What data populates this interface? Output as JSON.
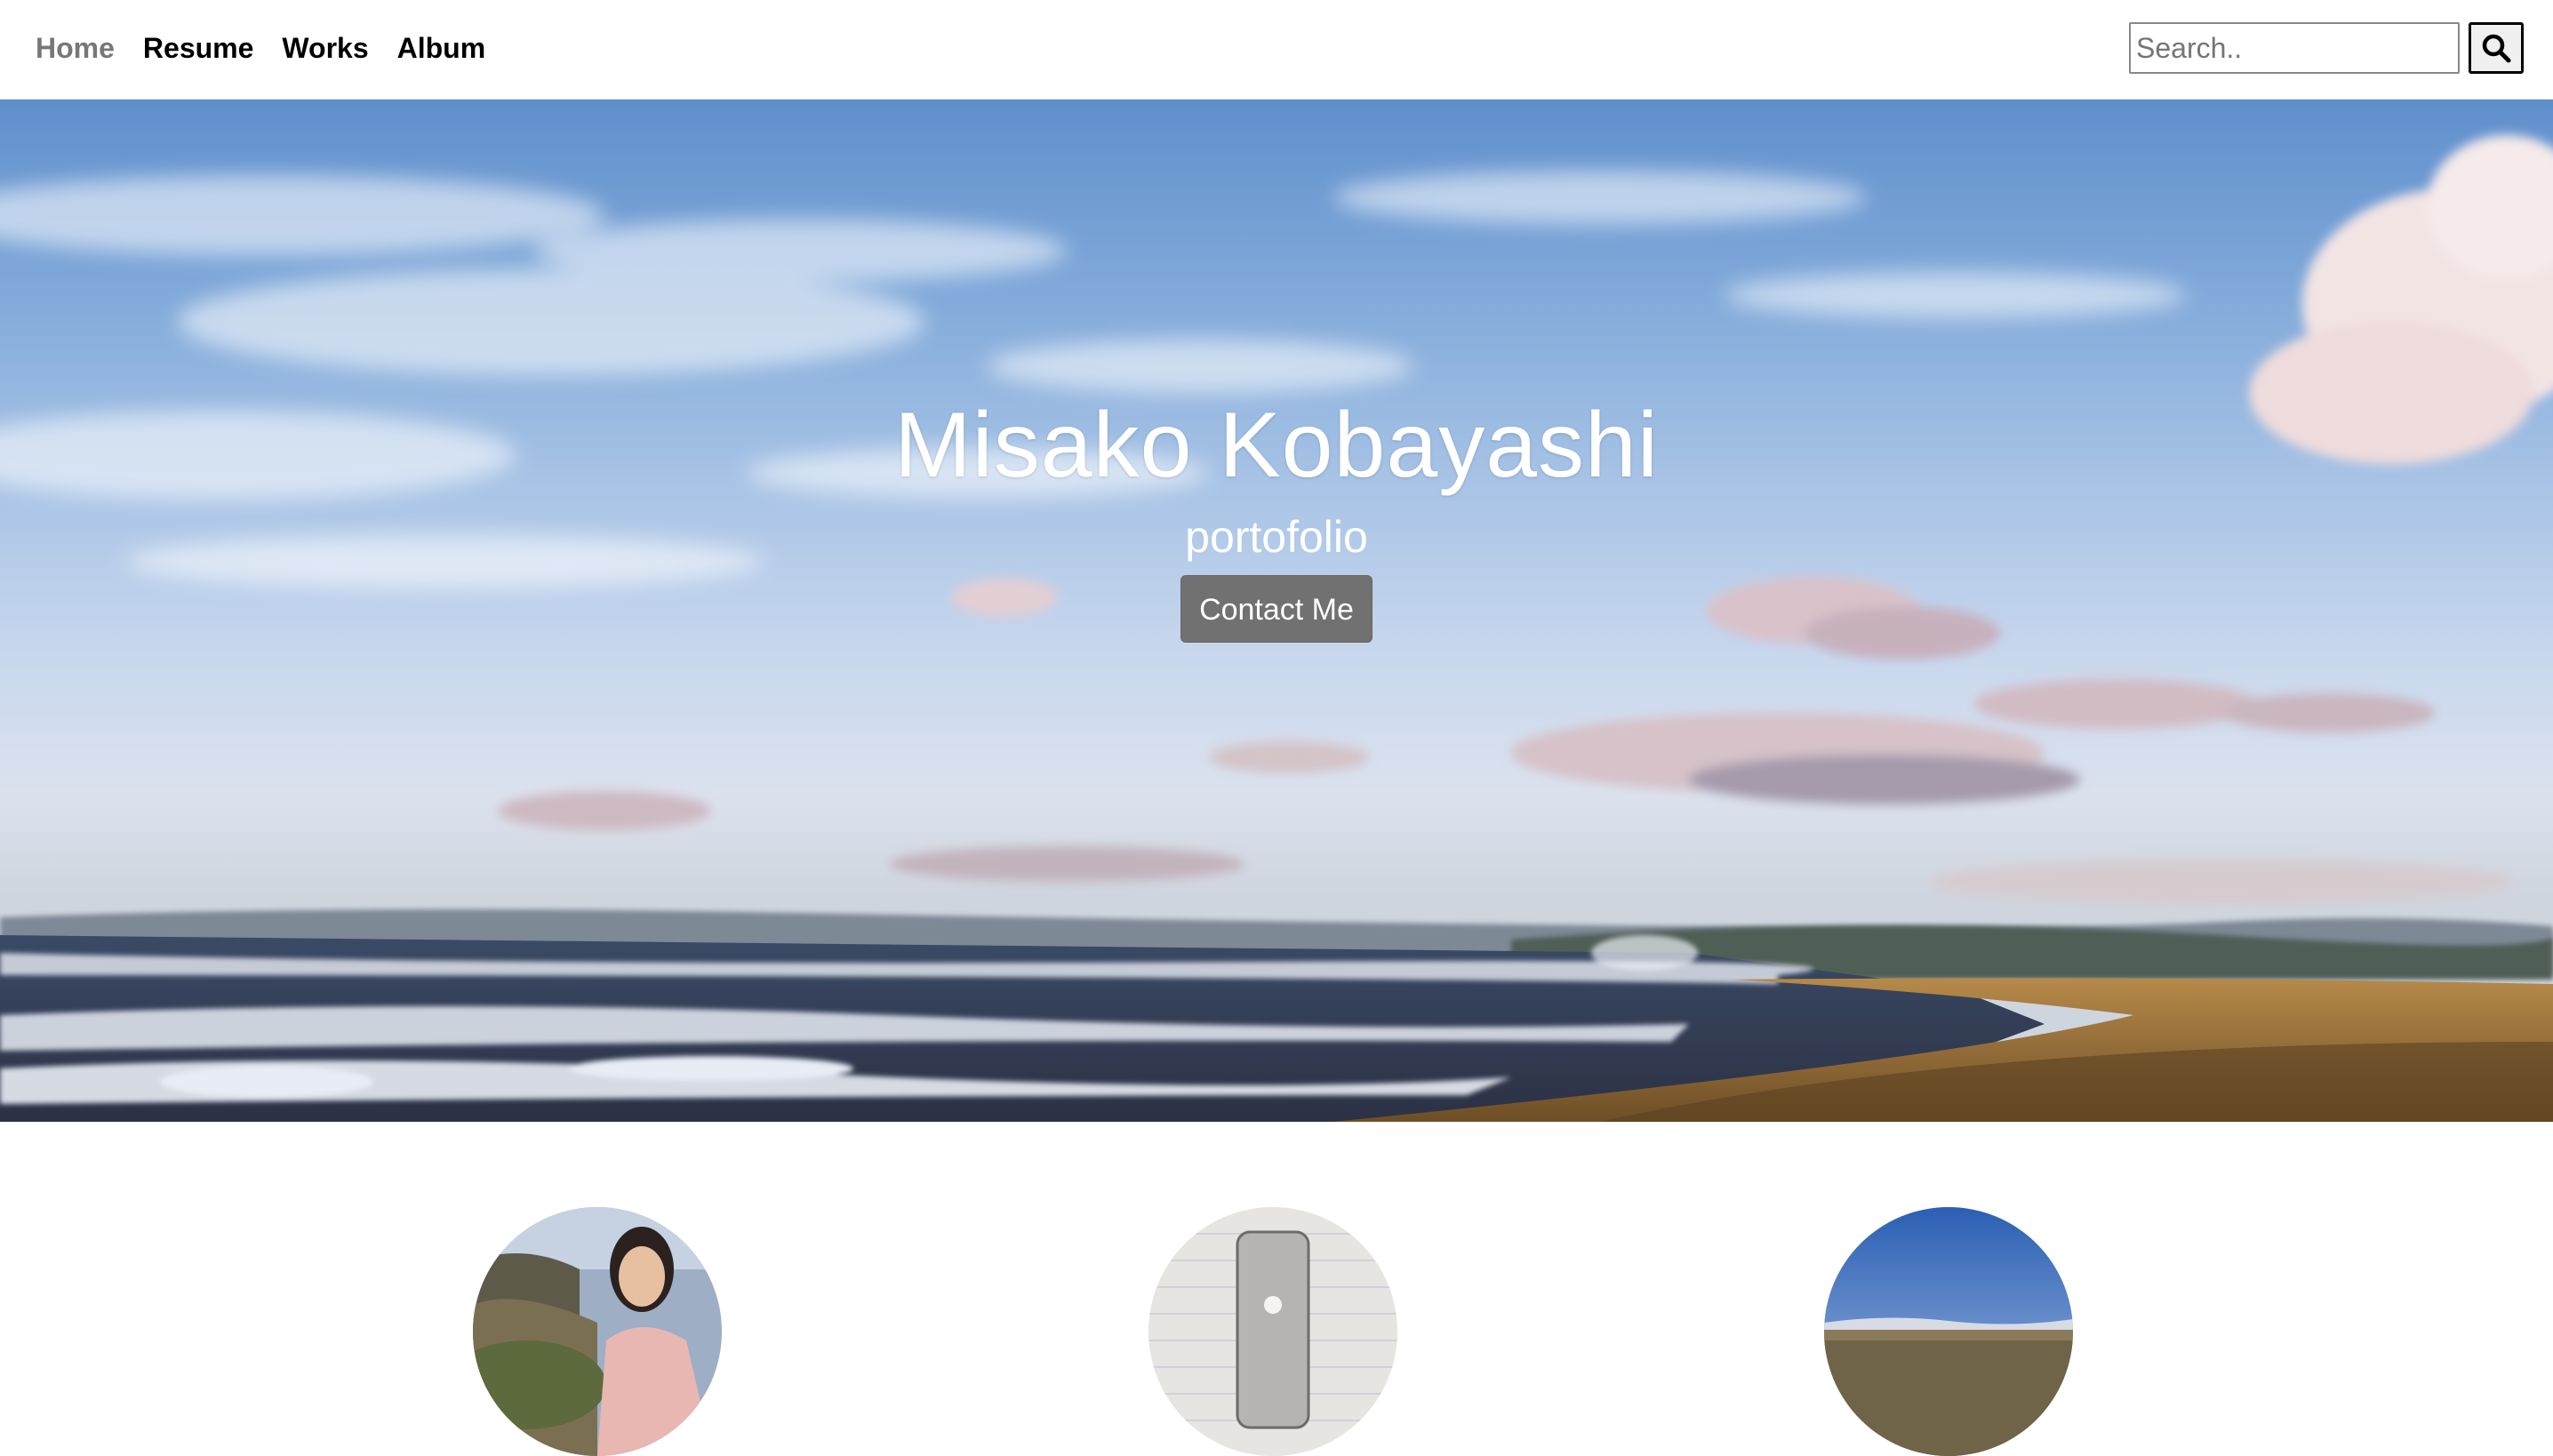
{
  "nav": {
    "links": [
      {
        "label": "Home",
        "active": true
      },
      {
        "label": "Resume",
        "active": false
      },
      {
        "label": "Works",
        "active": false
      },
      {
        "label": "Album",
        "active": false
      }
    ],
    "search": {
      "placeholder": "Search..",
      "button_icon": "search-icon"
    }
  },
  "hero": {
    "title": "Misako Kobayashi",
    "subtitle": "portofolio",
    "contact_label": "Contact Me",
    "background": "beach-sky-photo"
  },
  "cards": [
    {
      "image": "person-at-rocky-shore-photo"
    },
    {
      "image": "phone-sketch-photo"
    },
    {
      "image": "desert-sky-photo"
    }
  ],
  "colors": {
    "nav_active": "#777777",
    "nav_text": "#000000",
    "button_bg": "#717171",
    "hero_text": "#ffffff"
  }
}
